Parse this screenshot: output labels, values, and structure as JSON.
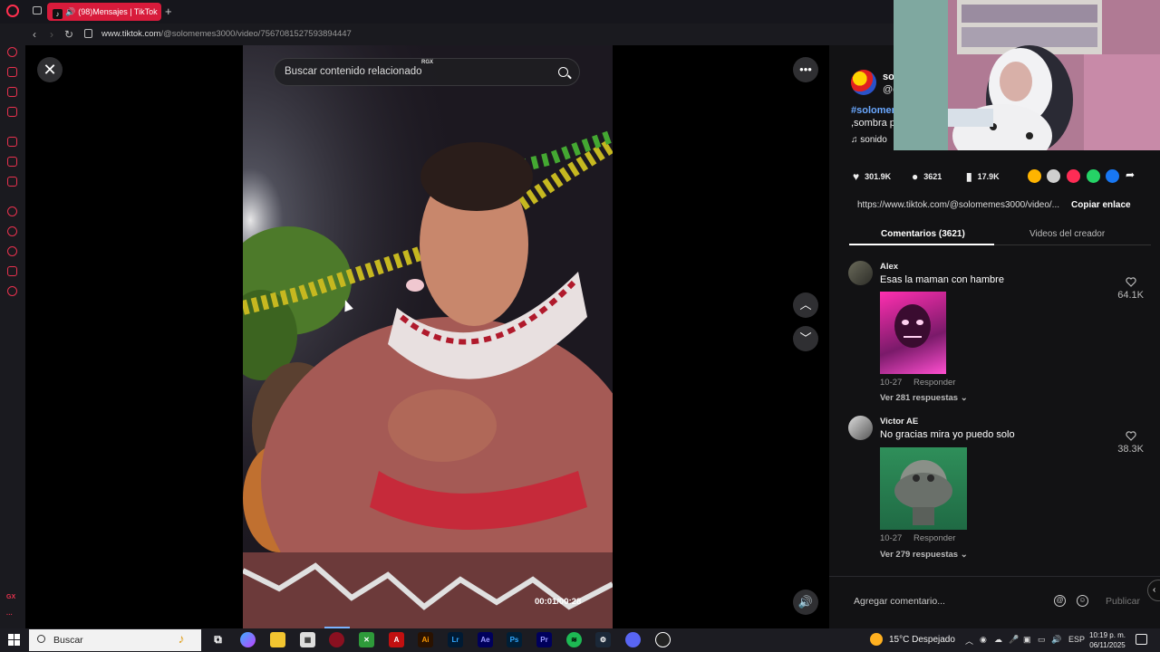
{
  "browser": {
    "tab_title": "(98)Mensajes | TikTok",
    "url_host": "www.tiktok.com",
    "url_path": "/@solomemes3000/video/7567081527593894447"
  },
  "sidebar": {
    "bottom_label": "GX"
  },
  "viewer": {
    "search_placeholder": "Buscar contenido relacionado",
    "overlay_tag": "RGX",
    "time": "00:01/00:28",
    "nav_up": "up-chevron-icon",
    "nav_down": "down-chevron-icon"
  },
  "author": {
    "name": "so",
    "handle": "@c",
    "description_hashtag": "#solomer",
    "description_text": ",sombra p",
    "sound_label": "sonido"
  },
  "stats": {
    "likes": "301.9K",
    "comments": "3621",
    "saves": "17.9K"
  },
  "share": {
    "colors": [
      "#ffb400",
      "#cfcfcf",
      "#fe2c55",
      "#25d366",
      "#1877f2"
    ]
  },
  "link": {
    "url": "https://www.tiktok.com/@solomemes3000/video/...",
    "copy_label": "Copiar enlace"
  },
  "tabs": {
    "comments": "Comentarios (3621)",
    "creator": "Videos del creador"
  },
  "comments": [
    {
      "name": "Alex",
      "text": "Esas la maman con hambre",
      "date": "10-27",
      "reply": "Responder",
      "replies": "Ver 281 respuestas",
      "likes": "64.1K"
    },
    {
      "name": "Victor AE",
      "text": "No gracias mira yo puedo solo",
      "date": "10-27",
      "reply": "Responder",
      "replies": "Ver 279 respuestas",
      "likes": "38.3K"
    }
  ],
  "comment_box": {
    "placeholder": "Agregar comentario...",
    "publish": "Publicar"
  },
  "taskbar": {
    "search": "Buscar",
    "apps": [
      "Ai",
      "Lr",
      "Ae",
      "Ps",
      "Pr"
    ],
    "weather": "15°C Despejado",
    "lang": "ESP",
    "time": "10:19 p. m.",
    "date": "06/11/2025"
  }
}
